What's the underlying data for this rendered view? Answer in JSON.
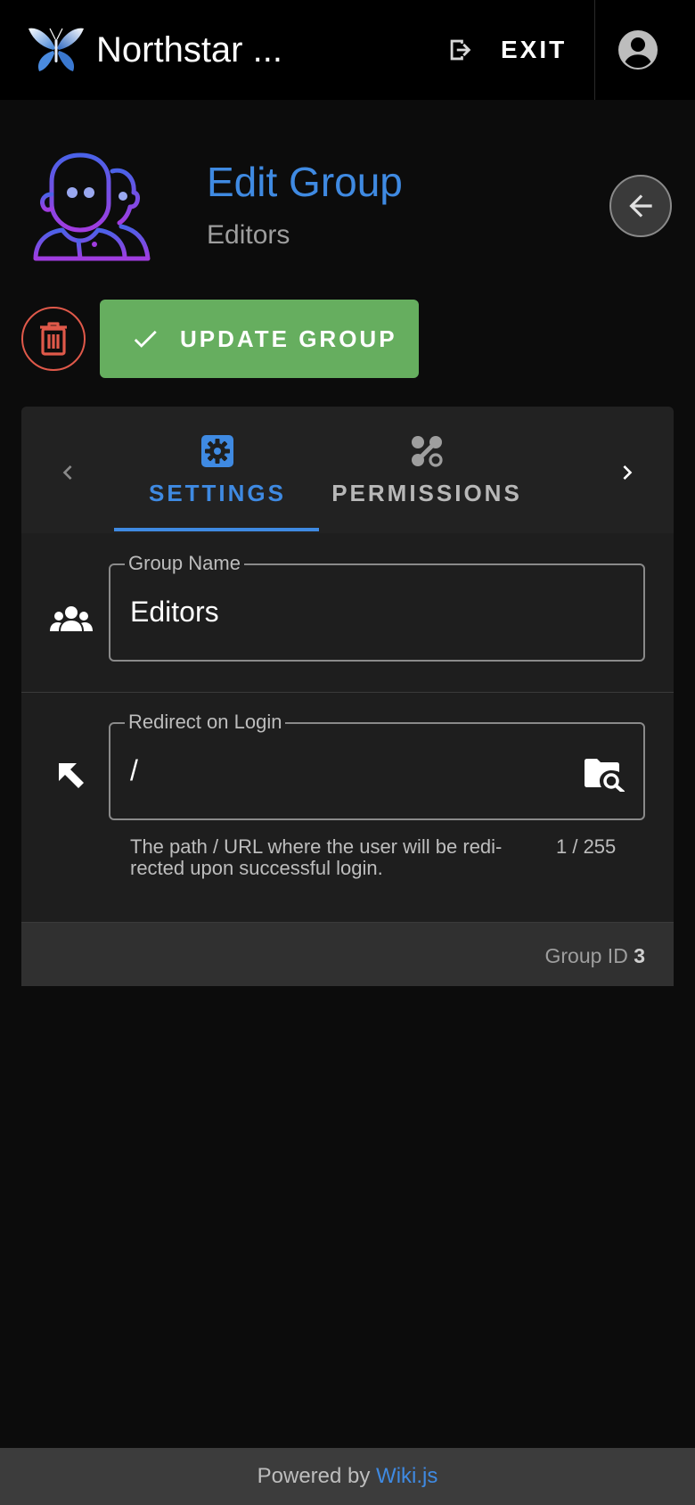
{
  "appbar": {
    "title": "Northstar ...",
    "exit_label": "EXIT",
    "logo_icon": "butterfly-logo",
    "exit_icon": "exit-icon",
    "account_icon": "account-circle-icon"
  },
  "header": {
    "title": "Edit Group",
    "subtitle": "Editors",
    "icon": "people-group-icon",
    "back_icon": "arrow-left-icon"
  },
  "actions": {
    "update_label": "UPDATE GROUP",
    "delete_icon": "trash-icon",
    "update_icon": "check-icon"
  },
  "tabs": {
    "items": [
      {
        "label": "SETTINGS",
        "icon": "gear-icon",
        "active": true
      },
      {
        "label": "PERMISSIONS",
        "icon": "permissions-icon",
        "active": false
      }
    ]
  },
  "form": {
    "group_name": {
      "label": "Group Name",
      "value": "Editors",
      "icon": "users-icon"
    },
    "redirect": {
      "label": "Redirect on Login",
      "value": "/",
      "icon": "arrow-up-left-icon",
      "hint": "The path / URL where the user will be redi- rected upon successful login.",
      "counter": "1 / 255",
      "browse_icon": "folder-search-icon"
    }
  },
  "footer_card": {
    "group_id_label": "Group ID",
    "group_id_value": "3"
  },
  "page_footer": {
    "powered_by": "Powered by",
    "link_text": "Wiki.js"
  },
  "colors": {
    "accent": "#3f8ae2",
    "success": "#66ae5f",
    "danger": "#e0594a",
    "background": "#0c0c0c"
  }
}
